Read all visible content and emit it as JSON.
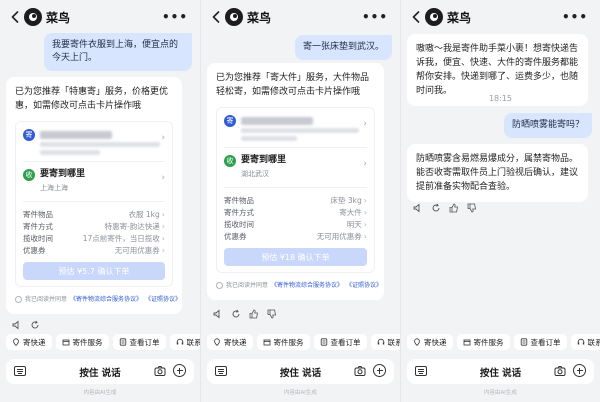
{
  "app": {
    "name": "菜鸟"
  },
  "screens": [
    {
      "user_message": "我要寄件衣服到上海，便宜点的今天上门。",
      "bot_intro": "已为您推荐「特惠寄」服务，价格更优惠，如需修改可点击卡片操作哦",
      "sender": {
        "badge": "寄"
      },
      "receiver": {
        "badge": "收",
        "title": "要寄到哪里",
        "region": "上海上海"
      },
      "fields": [
        {
          "label": "寄件物品",
          "value": "衣服 1kg"
        },
        {
          "label": "寄件方式",
          "value": "特惠寄-韵达快递"
        },
        {
          "label": "揽收时间",
          "value": "17点前寄件，当日揽收"
        },
        {
          "label": "优惠券",
          "value": "无可用优惠券"
        }
      ],
      "cta": "预估 ¥5.7 确认下单",
      "agreement": {
        "prefix": "我已阅读并同意",
        "link1": "《寄件物流综合服务协议》",
        "link2": "《证照协议》"
      }
    },
    {
      "user_message": "寄一张床垫到武汉。",
      "bot_intro": "已为您推荐「寄大件」服务，大件物品轻松寄，如需修改可点击卡片操作哦",
      "sender": {
        "badge": "寄"
      },
      "receiver": {
        "badge": "收",
        "title": "要寄到哪里",
        "region": "湖北武汉"
      },
      "fields": [
        {
          "label": "寄件物品",
          "value": "床垫 3kg"
        },
        {
          "label": "寄件方式",
          "value": "寄大件"
        },
        {
          "label": "揽收时间",
          "value": "明天"
        },
        {
          "label": "优惠券",
          "value": "无可用优惠券"
        }
      ],
      "cta": "预估 ¥18 确认下单",
      "agreement": {
        "prefix": "我已阅读并同意",
        "link1": "《寄件物流综合服务协议》",
        "link2": "《证照协议》"
      }
    },
    {
      "bot_greeting": "嗷嗷～我是寄件助手菜小裹！想寄快递告诉我，便宜、快速、大件的寄件服务都能帮你安排。快递到哪了、运费多少，也随时问我。",
      "time": "18:15",
      "user_message": "防晒喷雾能寄吗？",
      "bot_answer": "防晒喷雾含易燃易爆成分，属禁寄物品。能否收寄需取件员上门验视后确认，建议提前准备实物配合查验。"
    }
  ],
  "chips": [
    {
      "icon": "pin-icon",
      "label": "寄快递"
    },
    {
      "icon": "box-icon",
      "label": "寄件服务"
    },
    {
      "icon": "list-icon",
      "label": "查看订单"
    },
    {
      "icon": "headset-icon",
      "label": "联系客服"
    }
  ],
  "input": {
    "hold_to_talk": "按住 说话"
  },
  "ai_note": "内容由AI生成"
}
